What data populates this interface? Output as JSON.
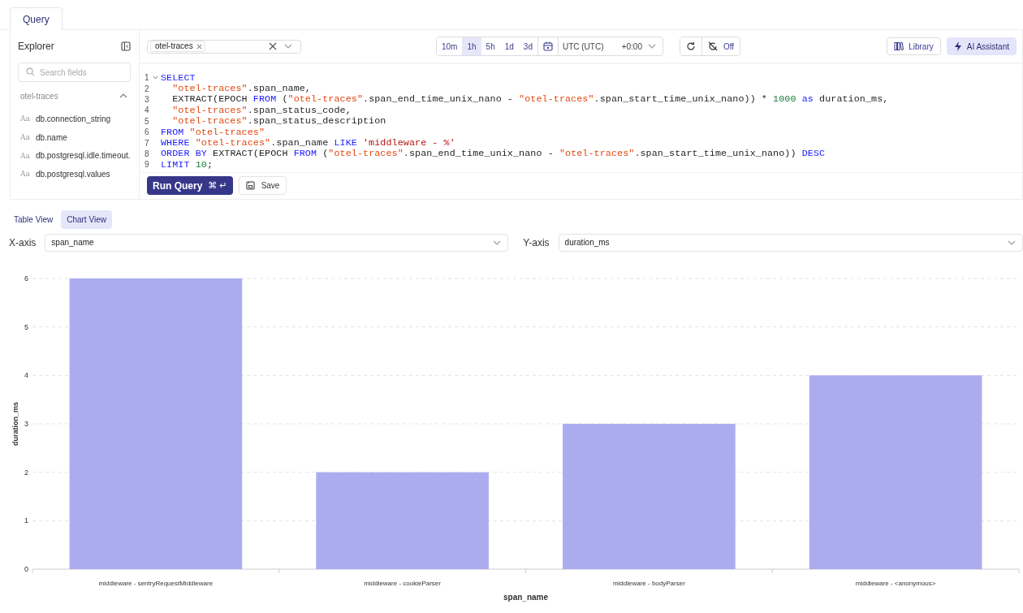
{
  "tabs": [
    {
      "label": "Query",
      "selected": true
    }
  ],
  "explorer": {
    "title": "Explorer",
    "search": {
      "placeholder": "Search fields"
    },
    "group": {
      "label": "otel-traces",
      "expanded": true
    },
    "fields": [
      {
        "type_icon": "Aa",
        "name": "db.connection_string"
      },
      {
        "type_icon": "Aa",
        "name": "db.name"
      },
      {
        "type_icon": "Aa",
        "name": "db.postgresql.idle.timeout."
      },
      {
        "type_icon": "Aa",
        "name": "db.postgresql.values"
      }
    ]
  },
  "source_select": {
    "tags": [
      "otel-traces"
    ]
  },
  "time_ranges": [
    {
      "label": "10m",
      "selected": false
    },
    {
      "label": "1h",
      "selected": true
    },
    {
      "label": "5h",
      "selected": false
    },
    {
      "label": "1d",
      "selected": false
    },
    {
      "label": "3d",
      "selected": false
    }
  ],
  "timezone": {
    "label": "UTC (UTC)",
    "offset": "+0:00"
  },
  "auto_refresh": {
    "label": "Off"
  },
  "toolbar_buttons": [
    {
      "label": "Library",
      "kind": "library"
    },
    {
      "label": "AI Assistant",
      "kind": "ai"
    }
  ],
  "code": [
    {
      "number": "1",
      "foldable": true,
      "tokens": [
        {
          "kind": "keyword",
          "text": "SELECT"
        }
      ]
    },
    {
      "number": "2",
      "foldable": false,
      "tokens": [
        {
          "kind": "string",
          "text": "  \"otel-traces\""
        },
        {
          "kind": "plain",
          "text": ".span_name,"
        }
      ]
    },
    {
      "number": "3",
      "foldable": false,
      "tokens": [
        {
          "kind": "plain",
          "text": "  EXTRACT(EPOCH "
        },
        {
          "kind": "keyword",
          "text": "FROM"
        },
        {
          "kind": "plain",
          "text": " ("
        },
        {
          "kind": "string",
          "text": "\"otel-traces\""
        },
        {
          "kind": "plain",
          "text": ".span_end_time_unix_nano - "
        },
        {
          "kind": "string",
          "text": "\"otel-traces\""
        },
        {
          "kind": "plain",
          "text": ".span_start_time_unix_nano)) * "
        },
        {
          "kind": "number",
          "text": "1000"
        },
        {
          "kind": "keyword",
          "text": " as"
        },
        {
          "kind": "plain",
          "text": " duration_ms,"
        }
      ]
    },
    {
      "number": "4",
      "foldable": false,
      "tokens": [
        {
          "kind": "string",
          "text": "  \"otel-traces\""
        },
        {
          "kind": "plain",
          "text": ".span_status_code,"
        }
      ]
    },
    {
      "number": "5",
      "foldable": false,
      "tokens": [
        {
          "kind": "string",
          "text": "  \"otel-traces\""
        },
        {
          "kind": "plain",
          "text": ".span_status_description"
        }
      ]
    },
    {
      "number": "6",
      "foldable": false,
      "tokens": [
        {
          "kind": "keyword",
          "text": "FROM"
        },
        {
          "kind": "string",
          "text": " \"otel-traces\""
        }
      ]
    },
    {
      "number": "7",
      "foldable": false,
      "tokens": [
        {
          "kind": "keyword",
          "text": "WHERE"
        },
        {
          "kind": "string",
          "text": " \"otel-traces\""
        },
        {
          "kind": "plain",
          "text": ".span_name "
        },
        {
          "kind": "keyword",
          "text": "LIKE"
        },
        {
          "kind": "literal",
          "text": " 'middleware - %'"
        }
      ]
    },
    {
      "number": "8",
      "foldable": false,
      "tokens": [
        {
          "kind": "keyword",
          "text": "ORDER BY"
        },
        {
          "kind": "plain",
          "text": " EXTRACT(EPOCH "
        },
        {
          "kind": "keyword",
          "text": "FROM"
        },
        {
          "kind": "plain",
          "text": " ("
        },
        {
          "kind": "string",
          "text": "\"otel-traces\""
        },
        {
          "kind": "plain",
          "text": ".span_end_time_unix_nano - "
        },
        {
          "kind": "string",
          "text": "\"otel-traces\""
        },
        {
          "kind": "plain",
          "text": ".span_start_time_unix_nano)) "
        },
        {
          "kind": "keyword",
          "text": "DESC"
        }
      ]
    },
    {
      "number": "9",
      "foldable": false,
      "tokens": [
        {
          "kind": "keyword",
          "text": "LIMIT"
        },
        {
          "kind": "number",
          "text": " 10"
        },
        {
          "kind": "plain",
          "text": ";"
        }
      ]
    }
  ],
  "run_button": {
    "label": "Run Query",
    "shortcut": "⌘ ↵"
  },
  "save_button": {
    "label": "Save"
  },
  "views": [
    {
      "label": "Table View",
      "selected": false
    },
    {
      "label": "Chart View",
      "selected": true
    }
  ],
  "x_axis": {
    "label": "X-axis",
    "value": "span_name"
  },
  "y_axis": {
    "label": "Y-axis",
    "value": "duration_ms"
  },
  "chart_data": {
    "type": "bar",
    "xlabel": "span_name",
    "ylabel": "duration_ms",
    "categories": [
      "middleware - sentryRequestMiddleware",
      "middleware - cookieParser",
      "middleware - bodyParser",
      "middleware - <anonymous>"
    ],
    "values": [
      6,
      2,
      3,
      4
    ],
    "ylim": [
      0,
      6
    ],
    "yticks": [
      0,
      1,
      2,
      3,
      4,
      5,
      6
    ],
    "grid": true
  }
}
